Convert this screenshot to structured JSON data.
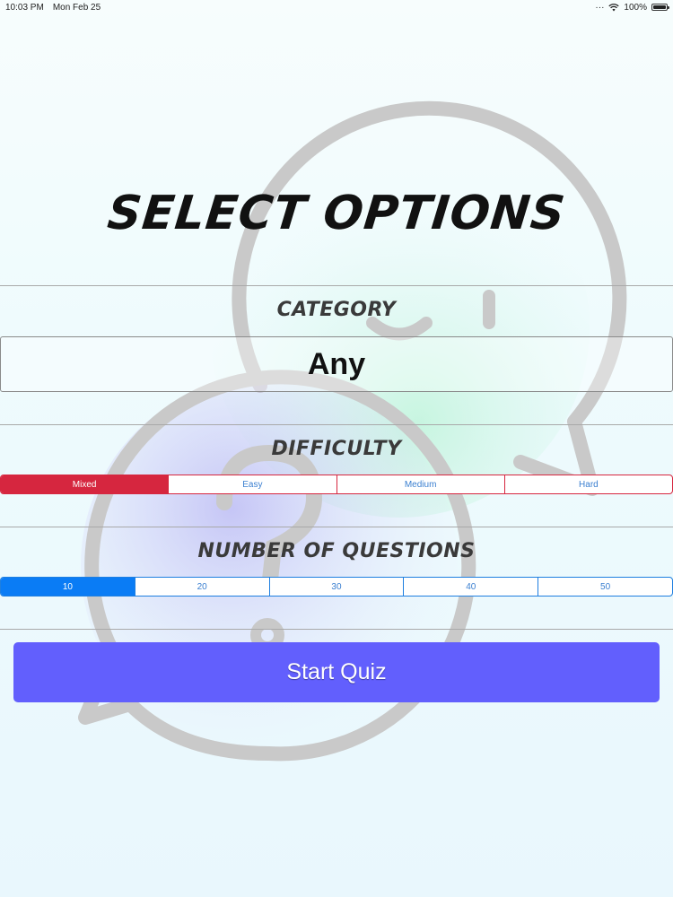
{
  "status_bar": {
    "time": "10:03 PM",
    "date": "Mon Feb 25",
    "battery": "100%"
  },
  "title": "SELECT OPTIONS",
  "category": {
    "label": "CATEGORY",
    "value": "Any"
  },
  "difficulty": {
    "label": "DIFFICULTY",
    "options": [
      "Mixed",
      "Easy",
      "Medium",
      "Hard"
    ],
    "selected": "Mixed"
  },
  "questions": {
    "label": "NUMBER OF QUESTIONS",
    "options": [
      "10",
      "20",
      "30",
      "40",
      "50"
    ],
    "selected": "10"
  },
  "start_button": {
    "label": "Start Quiz"
  },
  "colors": {
    "difficulty_accent": "#d6263f",
    "questions_accent": "#0a7cf5",
    "button": "#625ffd"
  }
}
